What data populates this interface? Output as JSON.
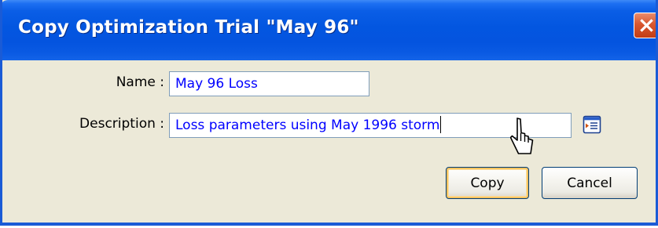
{
  "dialog": {
    "title": "Copy Optimization Trial \"May 96\"",
    "close_icon": "close-icon"
  },
  "form": {
    "name_label": "Name :",
    "name_value": "May 96 Loss",
    "description_label": "Description :",
    "description_value": "Loss parameters using May 1996 storm",
    "description_picker_icon": "text-editor-icon"
  },
  "buttons": {
    "copy_label": "Copy",
    "cancel_label": "Cancel"
  },
  "colors": {
    "title_bar": "#0356e0",
    "dialog_background": "#ece9d8",
    "field_text": "#0000ff",
    "close_button": "#d8572f",
    "default_button_highlight": "#f7c35f"
  }
}
